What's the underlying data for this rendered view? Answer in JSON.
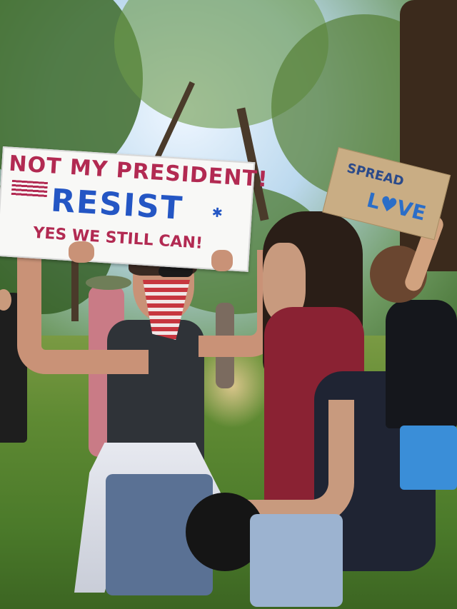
{
  "photo": {
    "main_sign": {
      "line1": "NOT MY PRESIDENT!",
      "line2": "RESIST",
      "line3": "YES WE STILL CAN!"
    },
    "right_sign": {
      "line1": "SPREAD",
      "line2": "L♥VE"
    }
  },
  "colors": {
    "sign_red": "#b22a52",
    "sign_blue": "#2456c4",
    "grass": "#4b7a2a",
    "cardboard": "#c9ad84"
  }
}
